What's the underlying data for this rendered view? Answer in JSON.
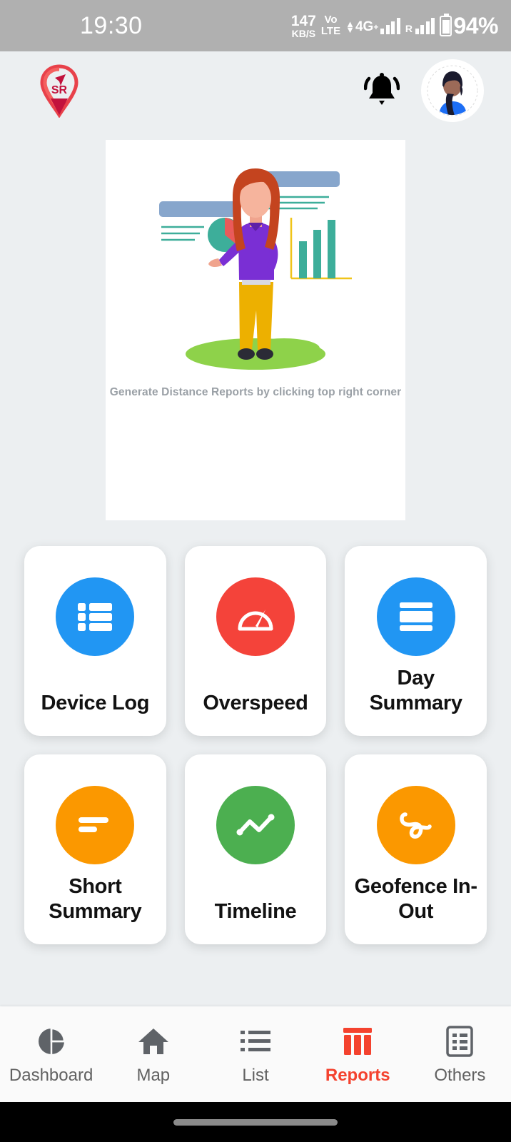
{
  "status_bar": {
    "time": "19:30",
    "data_rate_value": "147",
    "data_rate_unit": "KB/S",
    "volte_top": "Vo",
    "volte_bottom": "LTE",
    "network_type": "4G",
    "network_plus": "+",
    "roaming_label": "R",
    "battery_percent": "94%",
    "background": "#b0b0b0"
  },
  "header": {
    "logo_name": "SR",
    "bell_icon": "bell-icon",
    "avatar_icon": "user-avatar"
  },
  "illustration": {
    "caption": "Generate Distance Reports by clicking top right corner",
    "caption_color": "#9aa0a6"
  },
  "reports": {
    "cards": [
      {
        "label": "Device Log",
        "icon": "list-rows-icon",
        "color": "#2196f3"
      },
      {
        "label": "Overspeed",
        "icon": "speedometer-icon",
        "color": "#f4433a"
      },
      {
        "label": "Day Summary",
        "icon": "summary-bars-icon",
        "color": "#2196f3"
      },
      {
        "label": "Short Summary",
        "icon": "short-lines-icon",
        "color": "#fb9800"
      },
      {
        "label": "Timeline",
        "icon": "zigzag-line-icon",
        "color": "#4caf50"
      },
      {
        "label": "Geofence In-Out",
        "icon": "route-squiggle-icon",
        "color": "#fb9800"
      }
    ]
  },
  "bottom_nav": {
    "active_color": "#f4422e",
    "inactive_color": "#616161",
    "items": [
      {
        "label": "Dashboard",
        "icon": "pie-chart-icon",
        "active": false
      },
      {
        "label": "Map",
        "icon": "home-icon",
        "active": false
      },
      {
        "label": "List",
        "icon": "list-icon",
        "active": false
      },
      {
        "label": "Reports",
        "icon": "bar-chart-icon",
        "active": true
      },
      {
        "label": "Others",
        "icon": "document-icon",
        "active": false
      }
    ]
  }
}
